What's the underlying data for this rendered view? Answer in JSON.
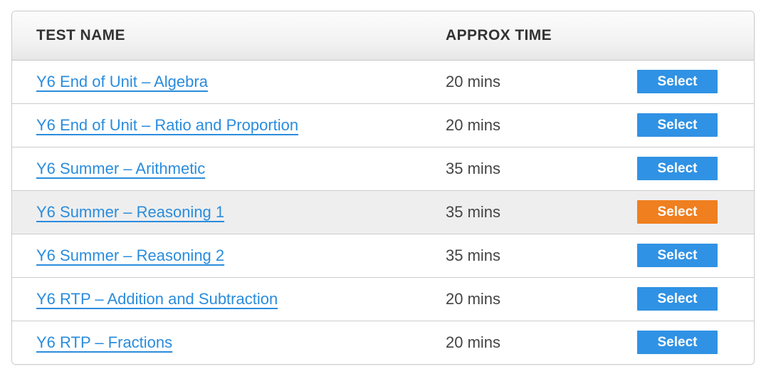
{
  "table": {
    "columns": {
      "name": "TEST NAME",
      "time": "APPROX TIME",
      "action": ""
    },
    "colors": {
      "link": "#2a8cdd",
      "button_default": "#3092e4",
      "button_active": "#ef7f1f",
      "row_active_background": "#eeeeee",
      "border": "#cccccc",
      "header_text": "#333333",
      "time_text": "#444444"
    },
    "rows": [
      {
        "name": "Y6 End of Unit – Algebra",
        "time": "20 mins",
        "button_label": "Select",
        "active": false
      },
      {
        "name": "Y6 End of Unit – Ratio and Proportion",
        "time": "20 mins",
        "button_label": "Select",
        "active": false
      },
      {
        "name": "Y6 Summer – Arithmetic",
        "time": "35 mins",
        "button_label": "Select",
        "active": false
      },
      {
        "name": "Y6 Summer – Reasoning 1",
        "time": "35 mins",
        "button_label": "Select",
        "active": true
      },
      {
        "name": "Y6 Summer – Reasoning 2",
        "time": "35 mins",
        "button_label": "Select",
        "active": false
      },
      {
        "name": "Y6 RTP – Addition and Subtraction",
        "time": "20 mins",
        "button_label": "Select",
        "active": false
      },
      {
        "name": "Y6 RTP – Fractions",
        "time": "20 mins",
        "button_label": "Select",
        "active": false
      }
    ]
  }
}
